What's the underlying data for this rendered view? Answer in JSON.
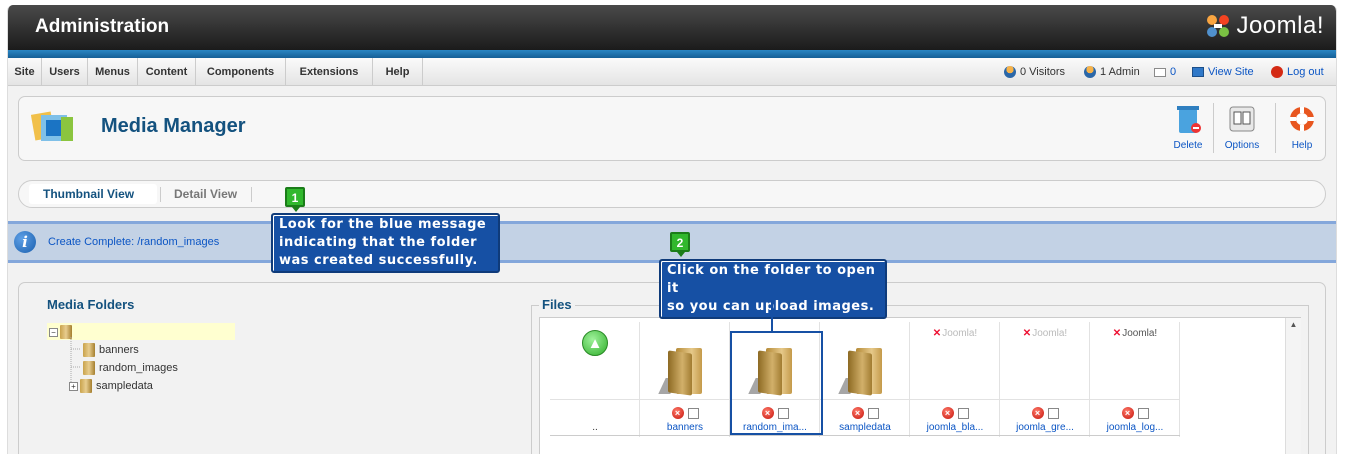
{
  "header": {
    "title": "Administration",
    "brand": "Joomla!"
  },
  "menu": {
    "items": [
      "Site",
      "Users",
      "Menus",
      "Content",
      "Components",
      "Extensions",
      "Help"
    ]
  },
  "status": {
    "visitors": "0 Visitors",
    "admins": "1 Admin",
    "messages": "0",
    "view_site": "View Site",
    "logout": "Log out"
  },
  "toolbar": {
    "title": "Media Manager",
    "delete_label": "Delete",
    "options_label": "Options",
    "help_label": "Help"
  },
  "tabs": {
    "thumbnail": "Thumbnail View",
    "detail": "Detail View"
  },
  "message": {
    "text": "Create Complete: /random_images"
  },
  "folders_panel": {
    "title": "Media Folders",
    "items": [
      "banners",
      "random_images",
      "sampledata"
    ]
  },
  "files_panel": {
    "title": "Files",
    "up_label": "..",
    "items": [
      {
        "name": "banners",
        "type": "folder"
      },
      {
        "name": "random_ima...",
        "type": "folder"
      },
      {
        "name": "sampledata",
        "type": "folder"
      },
      {
        "name": "joomla_bla...",
        "type": "image"
      },
      {
        "name": "joomla_gre...",
        "type": "image"
      },
      {
        "name": "joomla_log...",
        "type": "image"
      }
    ]
  },
  "annotations": {
    "badge1": "1",
    "badge2": "2",
    "callout1": [
      "Look for the blue message",
      "indicating that the folder",
      "was created successfully."
    ],
    "callout2": [
      "Click on the folder to open it",
      "so you can upload images."
    ]
  },
  "colors": {
    "accent": "#14527f",
    "link": "#0b55c4",
    "callout": "#1650a4",
    "badge": "#31b82d"
  }
}
